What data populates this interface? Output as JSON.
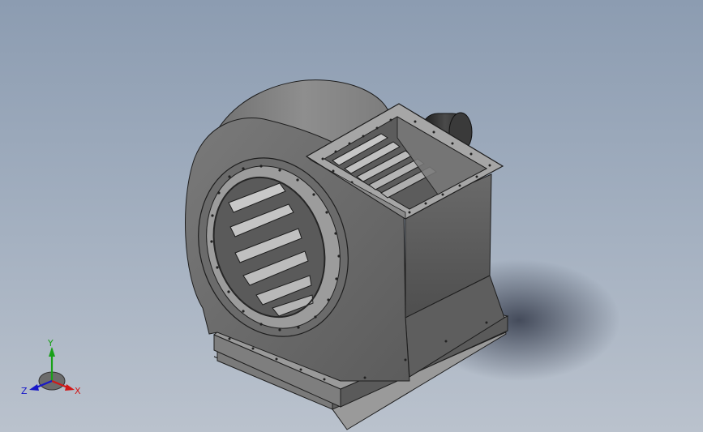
{
  "app": {
    "view": "isometric-3d-model-view",
    "model": "centrifugal-fan-assembly"
  },
  "colors": {
    "background_top": "#8c9cb1",
    "background_bottom": "#bac2cd",
    "housing_light": "#8d8d8d",
    "housing_dark": "#565656",
    "edge": "#1e1e1e",
    "axis_x": "#d01818",
    "axis_y": "#18a018",
    "axis_z": "#1818c8"
  },
  "triad": {
    "x_label": "X",
    "y_label": "Y",
    "z_label": "Z"
  }
}
